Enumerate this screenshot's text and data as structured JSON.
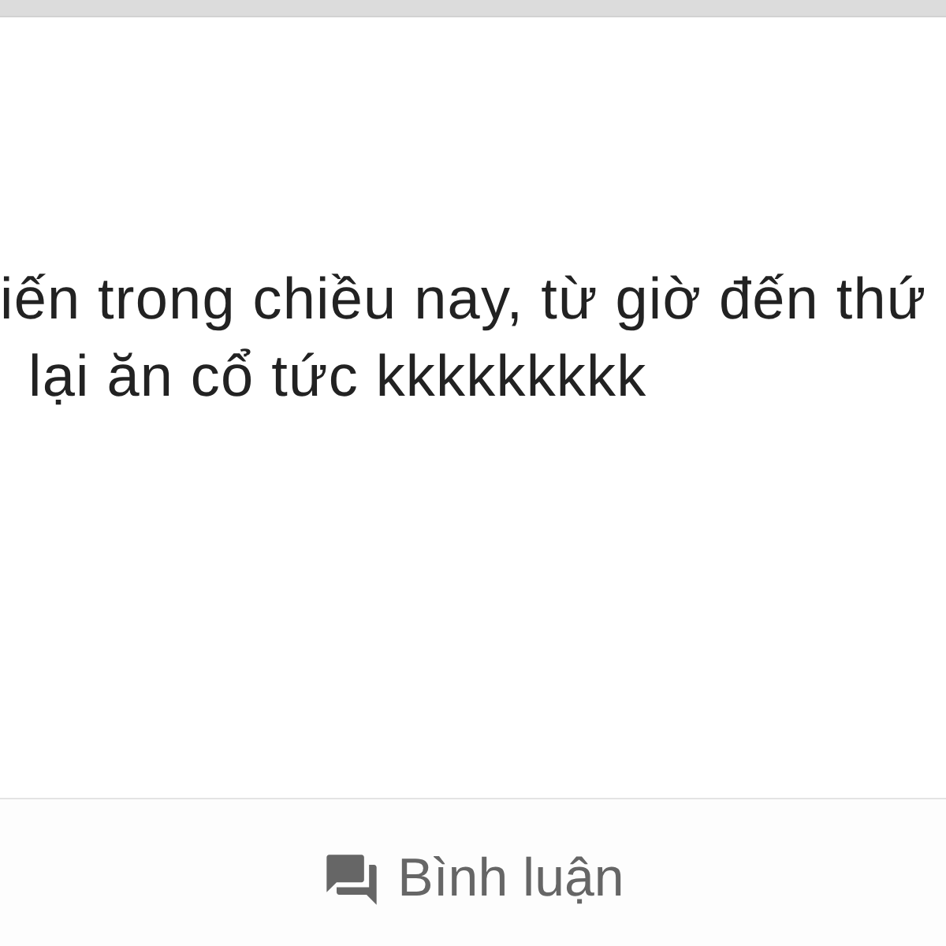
{
  "post": {
    "lines": [
      "iến trong chiều nay, từ giờ đến thứ",
      "lại ăn cổ tức kkkkkkkkk"
    ]
  },
  "footer": {
    "comment_button": {
      "label": "Bình luận"
    }
  }
}
